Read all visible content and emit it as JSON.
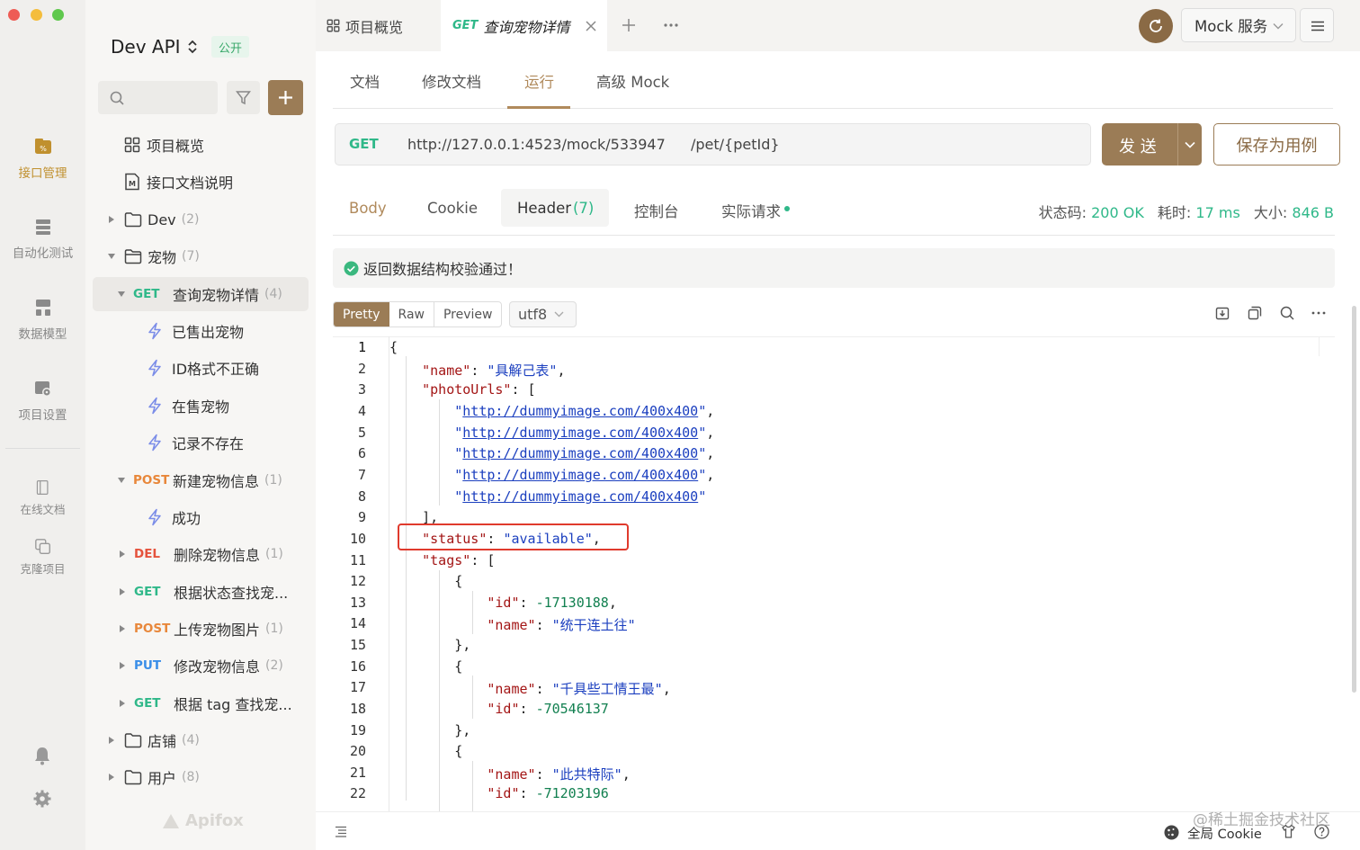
{
  "rail": {
    "items": [
      {
        "label": "接口管理",
        "active": true
      },
      {
        "label": "自动化测试"
      },
      {
        "label": "数据模型"
      },
      {
        "label": "项目设置"
      },
      {
        "label": "在线文档"
      },
      {
        "label": "克隆项目"
      }
    ],
    "accent": "#c0902e"
  },
  "sidebar": {
    "project_name": "Dev API",
    "visibility": "公开",
    "brand": "Apifox",
    "tree": [
      {
        "label": "项目概览"
      },
      {
        "label": "接口文档说明"
      },
      {
        "label": "Dev",
        "count": "(2)"
      },
      {
        "label": "宠物",
        "count": "(7)"
      },
      {
        "method": "GET",
        "label": "查询宠物详情",
        "count": "(4)"
      },
      {
        "label": "已售出宠物"
      },
      {
        "label": "ID格式不正确"
      },
      {
        "label": "在售宠物"
      },
      {
        "label": "记录不存在"
      },
      {
        "method": "POST",
        "label": "新建宠物信息",
        "count": "(1)"
      },
      {
        "label": "成功"
      },
      {
        "method": "DEL",
        "label": "删除宠物信息",
        "count": "(1)"
      },
      {
        "method": "GET",
        "label": "根据状态查找宠..."
      },
      {
        "method": "POST",
        "label": "上传宠物图片",
        "count": "(1)"
      },
      {
        "method": "PUT",
        "label": "修改宠物信息",
        "count": "(2)"
      },
      {
        "method": "GET",
        "label": "根据 tag 查找宠..."
      },
      {
        "label": "店铺",
        "count": "(4)"
      },
      {
        "label": "用户",
        "count": "(8)"
      }
    ]
  },
  "tabs": {
    "overview": "项目概览",
    "active_method": "GET",
    "active_label": "查询宠物详情",
    "mock_service": "Mock 服务"
  },
  "request_tabs": [
    "文档",
    "修改文档",
    "运行",
    "高级 Mock"
  ],
  "url_bar": {
    "method": "GET",
    "base": "http://127.0.0.1:4523/mock/533947",
    "path": "/pet/{petId}",
    "send": "发 送",
    "save": "保存为用例"
  },
  "response_tabs": {
    "body": "Body",
    "cookie": "Cookie",
    "header": "Header",
    "header_count": "(7)",
    "console": "控制台",
    "actual": "实际请求"
  },
  "stats": {
    "status_label": "状态码:",
    "status": "200 OK",
    "time_label": "耗时:",
    "time": "17 ms",
    "size_label": "大小:",
    "size": "846 B"
  },
  "validation": "返回数据结构校验通过！",
  "format_tabs": [
    "Pretty",
    "Raw",
    "Preview"
  ],
  "encoding": "utf8",
  "code_lines": [
    {
      "n": "1",
      "t": "{"
    },
    {
      "n": "2",
      "t": "    \"name\": \"具解己表\","
    },
    {
      "n": "3",
      "t": "    \"photoUrls\": ["
    },
    {
      "n": "4",
      "t": "        \"http://dummyimage.com/400x400\","
    },
    {
      "n": "5",
      "t": "        \"http://dummyimage.com/400x400\","
    },
    {
      "n": "6",
      "t": "        \"http://dummyimage.com/400x400\","
    },
    {
      "n": "7",
      "t": "        \"http://dummyimage.com/400x400\","
    },
    {
      "n": "8",
      "t": "        \"http://dummyimage.com/400x400\""
    },
    {
      "n": "9",
      "t": "    ],"
    },
    {
      "n": "10",
      "t": "    \"status\": \"available\","
    },
    {
      "n": "11",
      "t": "    \"tags\": ["
    },
    {
      "n": "12",
      "t": "        {"
    },
    {
      "n": "13",
      "t": "            \"id\": -17130188,"
    },
    {
      "n": "14",
      "t": "            \"name\": \"统干连土往\""
    },
    {
      "n": "15",
      "t": "        },"
    },
    {
      "n": "16",
      "t": "        {"
    },
    {
      "n": "17",
      "t": "            \"name\": \"千具些工情王最\","
    },
    {
      "n": "18",
      "t": "            \"id\": -70546137"
    },
    {
      "n": "19",
      "t": "        },"
    },
    {
      "n": "20",
      "t": "        {"
    },
    {
      "n": "21",
      "t": "            \"name\": \"此共特际\","
    },
    {
      "n": "22",
      "t": "            \"id\": -71203196"
    }
  ],
  "footer": {
    "global_cookie": "全局 Cookie",
    "watermark": "@稀土掘金技术社区"
  },
  "colors": {
    "get": "#2fb889",
    "post": "#e8873a",
    "del": "#e5533d",
    "put": "#3a8ee8",
    "brand": "#9b7c56",
    "highlight": "#e03a2d"
  }
}
